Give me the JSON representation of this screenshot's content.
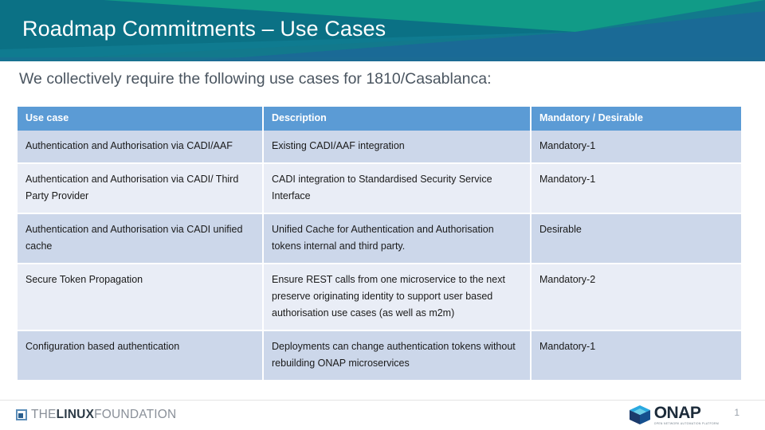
{
  "header": {
    "title": "Roadmap Commitments – Use Cases",
    "band_base_color": "#0b7185",
    "band_green_color": "#119b87",
    "band_blue_color": "#1a6a96",
    "title_color": "#ffffff"
  },
  "subtitle": "We collectively require the following use cases for 1810/Casablanca:",
  "table": {
    "header_bg": "#5b9bd5",
    "row_odd_bg": "#ccd7ea",
    "row_even_bg": "#e9edf6",
    "columns": [
      "Use case",
      "Description",
      "Mandatory / Desirable"
    ],
    "rows": [
      {
        "use_case": "Authentication and Authorisation via CADI/AAF",
        "description": "Existing CADI/AAF integration",
        "priority": "Mandatory-1"
      },
      {
        "use_case": "Authentication and Authorisation via CADI/ Third Party Provider",
        "description": "CADI integration to Standardised Security Service Interface",
        "priority": "Mandatory-1"
      },
      {
        "use_case": "Authentication and Authorisation via CADI unified cache",
        "description": "Unified Cache for Authentication and Authorisation tokens internal and third party.",
        "priority": "Desirable"
      },
      {
        "use_case": "Secure Token Propagation",
        "description": "Ensure REST calls from one microservice to the next preserve originating identity to support user based authorisation use cases (as well as m2m)",
        "priority": "Mandatory-2"
      },
      {
        "use_case": "Configuration based authentication",
        "description": "Deployments can change authentication tokens without rebuilding ONAP microservices",
        "priority": "Mandatory-1"
      }
    ]
  },
  "footer": {
    "linux_foundation": {
      "the": "THE",
      "linux": "LINUX",
      "foundation": "FOUNDATION"
    },
    "onap": {
      "wordmark": "ONAP",
      "tagline": "OPEN NETWORK AUTOMATION PLATFORM"
    },
    "page_number": "1"
  }
}
